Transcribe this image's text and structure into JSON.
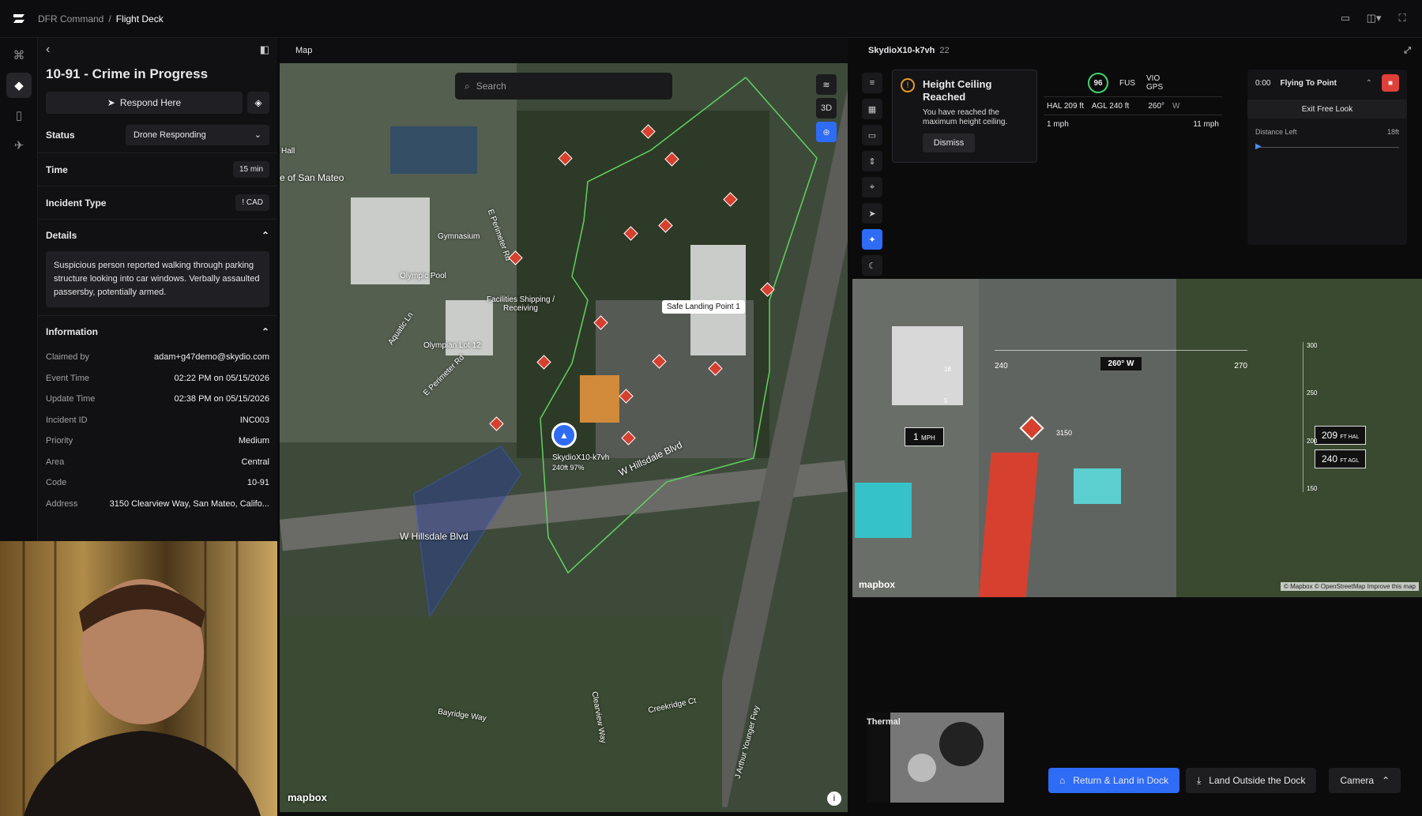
{
  "breadcrumb": {
    "root": "DFR Command",
    "sep": "/",
    "current": "Flight Deck"
  },
  "incident": {
    "title": "10-91 - Crime in Progress",
    "respond_label": "Respond Here",
    "status_label": "Status",
    "status_value": "Drone Responding",
    "time_label": "Time",
    "time_value": "15 min",
    "type_label": "Incident Type",
    "type_value": "CAD",
    "details_label": "Details",
    "details_text": "Suspicious person reported walking through parking structure looking into car windows. Verbally assaulted passersby, potentially armed.",
    "information_label": "Information",
    "info": [
      {
        "k": "Claimed by",
        "v": "adam+g47demo@skydio.com"
      },
      {
        "k": "Event Time",
        "v": "02:22 PM on 05/15/2026"
      },
      {
        "k": "Update Time",
        "v": "02:38 PM on 05/15/2026"
      },
      {
        "k": "Incident ID",
        "v": "INC003"
      },
      {
        "k": "Priority",
        "v": "Medium"
      },
      {
        "k": "Area",
        "v": "Central"
      },
      {
        "k": "Code",
        "v": "10-91"
      },
      {
        "k": "Address",
        "v": "3150 Clearview Way, San Mateo, Califo..."
      }
    ]
  },
  "map": {
    "header": "Map",
    "search_placeholder": "Search",
    "btn_3d": "3D",
    "attribution": "mapbox",
    "labels": {
      "san_mateo": "e of San Mateo",
      "hall": "Hall",
      "gym": "Gymnasium",
      "pool": "Olympic Pool",
      "facilities": "Facilities Shipping / Receiving",
      "lot12": "Olympian Lot 12",
      "eperim": "E Perimeter Rd",
      "eperim2": "E Perimeter Rd",
      "aquatic": "Aquatic Ln",
      "hills1": "W Hillsdale Blvd",
      "hills2": "W Hillsdale Blvd",
      "safe": "Safe Landing Point 1",
      "drone": "SkydioX10-k7vh",
      "drone_sub": "240ft 97%",
      "bayridge": "Bayridge Way",
      "clearview": "Clearview Way",
      "creekridge": "Creekridge Ct",
      "fwy": "J Arthur Younger Fwy"
    }
  },
  "drone": {
    "name": "SkydioX10-k7vh",
    "count": "22",
    "alert_title": "Height Ceiling Reached",
    "alert_body": "You have reached the maximum height ceiling.",
    "dismiss": "Dismiss",
    "battery": "96",
    "fus": "FUS",
    "vio": "VIO",
    "gps": "GPS",
    "hal": "HAL 209 ft",
    "agl": "AGL 240 ft",
    "heading": "260°",
    "heading_dir": "W",
    "speed": "1 mph",
    "wind": "11 mph",
    "timer": "0:00",
    "mode": "Flying To Point",
    "exit": "Exit Free Look",
    "dist_label": "Distance Left",
    "dist_val": "18ft"
  },
  "camera": {
    "heading": "260°",
    "heading_dir": "W",
    "tick_left": "240",
    "tick_right": "270",
    "speed": "1",
    "speed_unit": "MPH",
    "hal": "209",
    "hal_unit": "FT HAL",
    "agl": "240",
    "agl_unit": "FT AGL",
    "scale": [
      "300",
      "250",
      "200",
      "150"
    ],
    "addr": "3150",
    "attribution": "mapbox",
    "copyright": "© Mapbox © OpenStreetMap  Improve this map",
    "alt_marks": [
      "18",
      "5"
    ]
  },
  "thermal_label": "Thermal",
  "actions": {
    "rtd": "Return & Land in Dock",
    "land": "Land Outside the Dock",
    "camera": "Camera"
  }
}
